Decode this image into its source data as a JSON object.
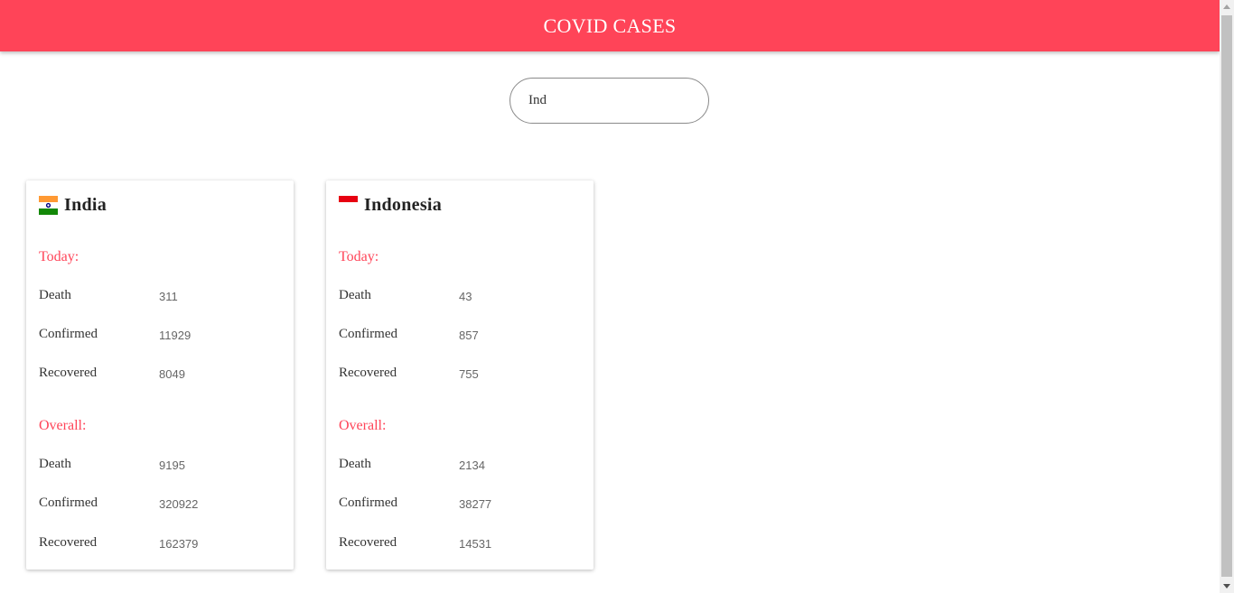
{
  "header": {
    "title": "COVID CASES",
    "bg_color": "#ff4458"
  },
  "search": {
    "value": "Ind",
    "placeholder": ""
  },
  "accent_color": "#ff4458",
  "cards": [
    {
      "country": "India",
      "flag_icon": "india-flag-icon",
      "today": {
        "label": "Today:",
        "rows": [
          {
            "label": "Death",
            "value": "311"
          },
          {
            "label": "Confirmed",
            "value": "11929"
          },
          {
            "label": "Recovered",
            "value": "8049"
          }
        ]
      },
      "overall": {
        "label": "Overall:",
        "rows": [
          {
            "label": "Death",
            "value": "9195"
          },
          {
            "label": "Confirmed",
            "value": "320922"
          },
          {
            "label": "Recovered",
            "value": "162379"
          }
        ]
      }
    },
    {
      "country": "Indonesia",
      "flag_icon": "indonesia-flag-icon",
      "today": {
        "label": "Today:",
        "rows": [
          {
            "label": "Death",
            "value": "43"
          },
          {
            "label": "Confirmed",
            "value": "857"
          },
          {
            "label": "Recovered",
            "value": "755"
          }
        ]
      },
      "overall": {
        "label": "Overall:",
        "rows": [
          {
            "label": "Death",
            "value": "2134"
          },
          {
            "label": "Confirmed",
            "value": "38277"
          },
          {
            "label": "Recovered",
            "value": "14531"
          }
        ]
      }
    }
  ]
}
